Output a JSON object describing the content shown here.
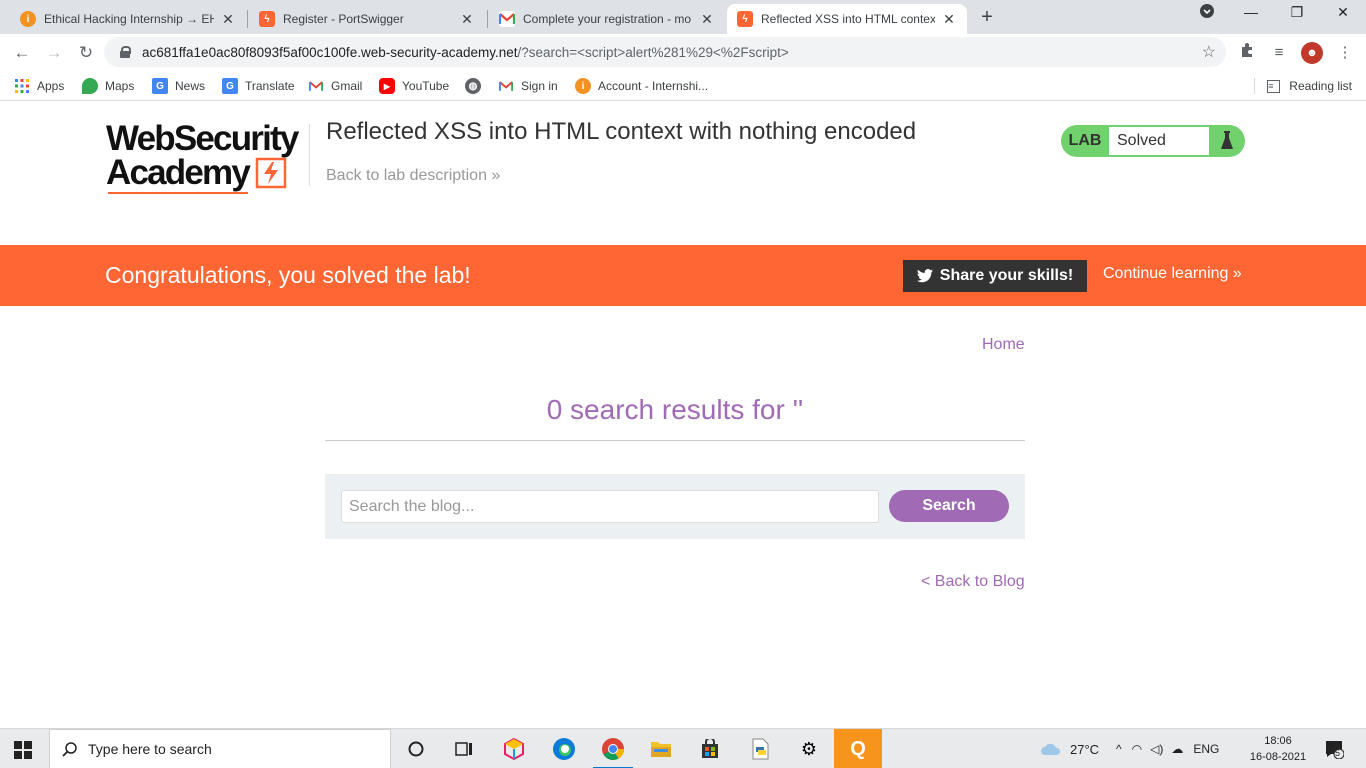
{
  "browser": {
    "tabs": [
      {
        "title": "Ethical Hacking Internship → EH (",
        "favicon_color": "#f29222",
        "active": false
      },
      {
        "title": "Register - PortSwigger",
        "favicon_color": "#ff6633",
        "active": false
      },
      {
        "title": "Complete your registration - mo",
        "favicon_color": "#ffffff",
        "active": false
      },
      {
        "title": "Reflected XSS into HTML context",
        "favicon_color": "#ff6633",
        "active": true
      }
    ],
    "new_tab": "+",
    "url_host": "ac681ffa1e0ac80f8093f5af00c100fe.web-security-academy.net",
    "url_rest": "/?search=<script>alert%281%29<%2Fscript>",
    "bookmarks": [
      {
        "label": "Apps",
        "icon": "apps-grid-icon"
      },
      {
        "label": "Maps",
        "icon": "maps-icon"
      },
      {
        "label": "News",
        "icon": "news-icon"
      },
      {
        "label": "Translate",
        "icon": "translate-icon"
      },
      {
        "label": "Gmail",
        "icon": "gmail-icon"
      },
      {
        "label": "YouTube",
        "icon": "youtube-icon"
      },
      {
        "label": "",
        "icon": "globe-icon"
      },
      {
        "label": "Sign in",
        "icon": "gmail-icon"
      },
      {
        "label": "Account - Internshi...",
        "icon": "account-icon"
      }
    ],
    "reading_list": "Reading list"
  },
  "page": {
    "logo_line1": "WebSecurity",
    "logo_line2": "Academy",
    "lab_title": "Reflected XSS into HTML context with nothing encoded",
    "back_to_description": "Back to lab description",
    "back_to_description_arrow": "»",
    "status_label": "LAB",
    "status_value": "Solved",
    "banner_message": "Congratulations, you solved the lab!",
    "share_button": "Share your skills!",
    "continue_learning": "Continue learning",
    "continue_arrow": "»",
    "home_link": "Home",
    "results_heading": "0 search results for ''",
    "search_placeholder": "Search the blog...",
    "search_button": "Search",
    "back_to_blog": "< Back to Blog",
    "colors": {
      "accent": "#ff6633",
      "link": "#a06ab4",
      "solved": "#70d16d"
    }
  },
  "taskbar": {
    "search_placeholder": "Type here to search",
    "weather": "27°C",
    "language": "ENG",
    "time": "18:06",
    "date": "16-08-2021",
    "notification_count": "5"
  }
}
